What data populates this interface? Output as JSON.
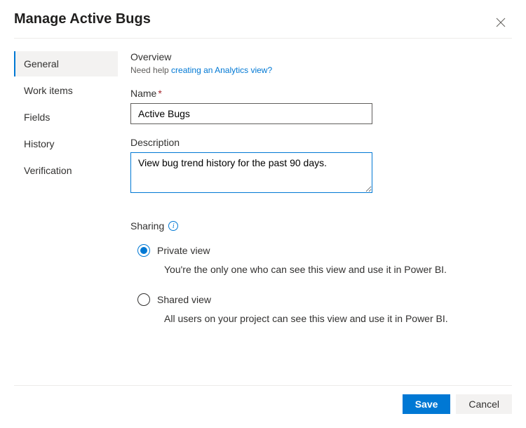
{
  "header": {
    "title": "Manage Active Bugs"
  },
  "sidebar": {
    "items": [
      {
        "label": "General",
        "active": true
      },
      {
        "label": "Work items",
        "active": false
      },
      {
        "label": "Fields",
        "active": false
      },
      {
        "label": "History",
        "active": false
      },
      {
        "label": "Verification",
        "active": false
      }
    ]
  },
  "overview": {
    "heading": "Overview",
    "help_prefix": "Need help ",
    "help_link": "creating an Analytics view?"
  },
  "form": {
    "name_label": "Name",
    "name_value": "Active Bugs",
    "description_label": "Description",
    "description_value": "View bug trend history for the past 90 days."
  },
  "sharing": {
    "label": "Sharing",
    "options": [
      {
        "label": "Private view",
        "description": "You're the only one who can see this view and use it in Power BI.",
        "selected": true
      },
      {
        "label": "Shared view",
        "description": "All users on your project can see this view and use it in Power BI.",
        "selected": false
      }
    ]
  },
  "footer": {
    "save": "Save",
    "cancel": "Cancel"
  }
}
